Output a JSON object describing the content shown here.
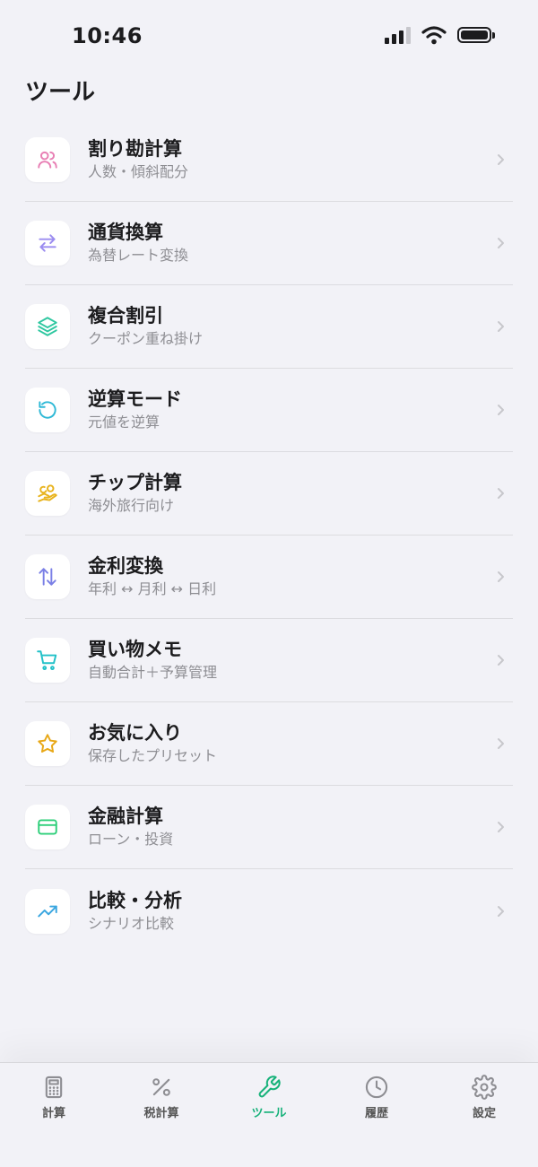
{
  "status_bar": {
    "time": "10:46"
  },
  "page": {
    "title": "ツール"
  },
  "tools": [
    {
      "title": "割り勘計算",
      "subtitle": "人数・傾斜配分",
      "icon": "users-icon",
      "color": "#e87fb4"
    },
    {
      "title": "通貨換算",
      "subtitle": "為替レート変換",
      "icon": "arrows-swap-icon",
      "color": "#9b8cf0"
    },
    {
      "title": "複合割引",
      "subtitle": "クーポン重ね掛け",
      "icon": "layers-icon",
      "color": "#2ec7a0"
    },
    {
      "title": "逆算モード",
      "subtitle": "元値を逆算",
      "icon": "rotate-ccw-icon",
      "color": "#2fb9d6"
    },
    {
      "title": "チップ計算",
      "subtitle": "海外旅行向け",
      "icon": "hand-coins-icon",
      "color": "#e8b31c"
    },
    {
      "title": "金利変換",
      "subtitle": "年利 ↔ 月利 ↔ 日利",
      "icon": "arrow-up-down-icon",
      "color": "#7a7fe6"
    },
    {
      "title": "買い物メモ",
      "subtitle": "自動合計＋予算管理",
      "icon": "cart-icon",
      "color": "#22c1c8"
    },
    {
      "title": "お気に入り",
      "subtitle": "保存したプリセット",
      "icon": "star-icon",
      "color": "#e8a817"
    },
    {
      "title": "金融計算",
      "subtitle": "ローン・投資",
      "icon": "credit-card-icon",
      "color": "#2ecf7a"
    },
    {
      "title": "比較・分析",
      "subtitle": "シナリオ比較",
      "icon": "trending-up-icon",
      "color": "#3aa6e0"
    }
  ],
  "tab_bar": {
    "accent": "#17b27a",
    "tabs": [
      {
        "label": "計算",
        "icon": "calculator-icon",
        "active": false
      },
      {
        "label": "税計算",
        "icon": "percent-icon",
        "active": false
      },
      {
        "label": "ツール",
        "icon": "wrench-icon",
        "active": true
      },
      {
        "label": "履歴",
        "icon": "clock-icon",
        "active": false
      },
      {
        "label": "設定",
        "icon": "gear-icon",
        "active": false
      }
    ]
  }
}
